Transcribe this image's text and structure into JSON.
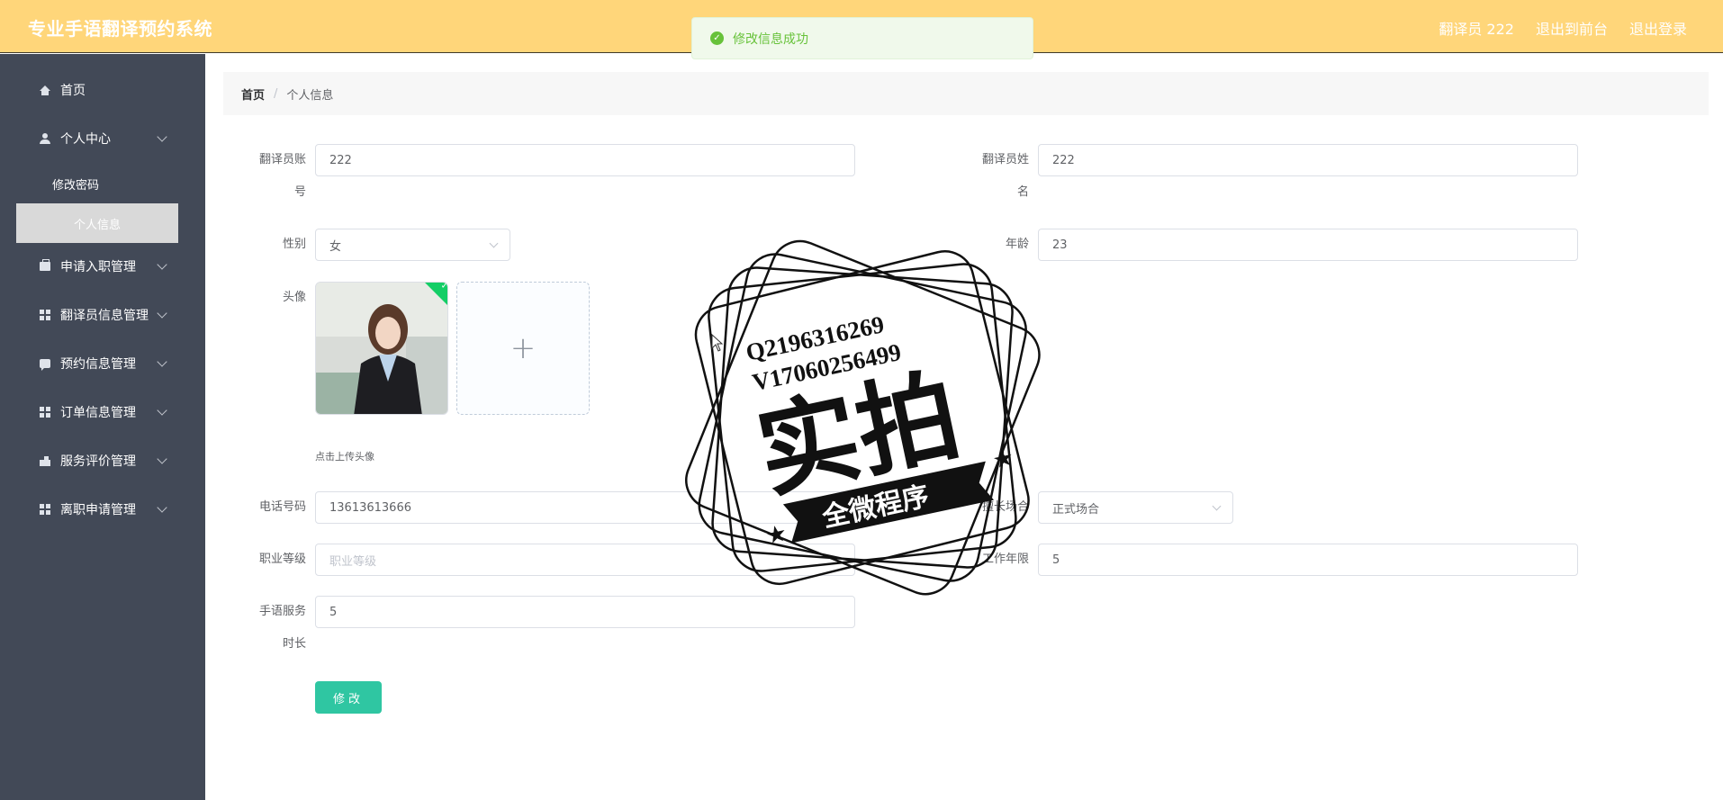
{
  "header": {
    "app_title": "专业手语翻译预约系统",
    "user_label": "翻译员 222",
    "to_frontend": "退出到前台",
    "logout": "退出登录",
    "bg_color": "#ffd67a"
  },
  "toast": {
    "message": "修改信息成功",
    "type": "success"
  },
  "sidebar": {
    "items": [
      {
        "label": "首页",
        "icon": "home-icon"
      },
      {
        "label": "个人中心",
        "icon": "user-icon"
      },
      {
        "label": "修改密码"
      },
      {
        "label": "个人信息"
      },
      {
        "label": "申请入职管理",
        "icon": "briefcase-icon"
      },
      {
        "label": "翻译员信息管理",
        "icon": "grid-icon"
      },
      {
        "label": "预约信息管理",
        "icon": "chat-icon"
      },
      {
        "label": "订单信息管理",
        "icon": "grid-icon"
      },
      {
        "label": "服务评价管理",
        "icon": "building-icon"
      },
      {
        "label": "离职申请管理",
        "icon": "grid-icon"
      }
    ]
  },
  "breadcrumb": {
    "home": "首页",
    "separator": "/",
    "current": "个人信息"
  },
  "form": {
    "account_label_1": "翻译员账",
    "account_label_2": "号",
    "account_value": "222",
    "name_label_1": "翻译员姓",
    "name_label_2": "名",
    "name_value": "222",
    "gender_label": "性别",
    "gender_value": "女",
    "age_label": "年龄",
    "age_value": "23",
    "avatar_label": "头像",
    "upload_hint": "点击上传头像",
    "upload_plus": "+",
    "phone_label": "电话号码",
    "phone_value": "13613613666",
    "occasion_label": "擅长场合",
    "occasion_value": "正式场合",
    "level_label": "职业等级",
    "level_placeholder": "职业等级",
    "years_label": "工作年限",
    "years_value": "5",
    "duration_label_1": "手语服务",
    "duration_label_2": "时长",
    "duration_value": "5",
    "submit_label": "修改"
  },
  "watermark": {
    "line1": "Q2196316269",
    "line2": "V17060256499",
    "big_text": "实拍",
    "ribbon": "全微程序"
  }
}
